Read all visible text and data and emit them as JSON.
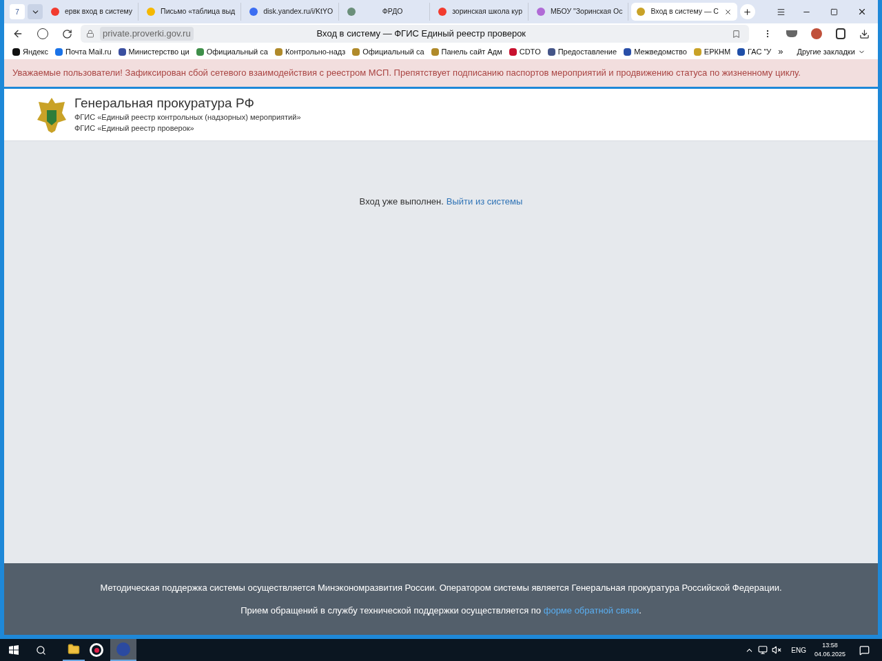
{
  "browser": {
    "tab_count": "7",
    "tabs": [
      {
        "title": "ервк вход в систему",
        "selected": false
      },
      {
        "title": "Письмо «таблица выд",
        "selected": false
      },
      {
        "title": "disk.yandex.ru/i/KtYO",
        "selected": false
      },
      {
        "title": "ФРДО",
        "selected": false
      },
      {
        "title": "зоринская школа кур",
        "selected": false
      },
      {
        "title": "МБОУ \"Зоринская Ос",
        "selected": false
      },
      {
        "title": "Вход в систему — С",
        "selected": true
      }
    ],
    "url": "private.proverki.gov.ru",
    "page_title": "Вход в систему — ФГИС Единый реестр проверок",
    "bookmarks": [
      "Яндекс",
      "Почта Mail.ru",
      "Министерство ци",
      "Официальный са",
      "Контрольно-надз",
      "Официальный са",
      "Панель сайт Адм",
      "CDTO",
      "Предоставление",
      "Межведомство",
      "ЕРКНМ",
      "ГАС \"У"
    ],
    "more_bookmarks": "»",
    "other_bookmarks": "Другие закладки"
  },
  "alert": "Уважаемые пользователи! Зафиксирован сбой сетевого взаимодействия с реестром МСП. Препятствует подписанию паспортов мероприятий и продвижению статуса по жизненному циклу.",
  "header": {
    "title": "Генеральная прокуратура РФ",
    "subtitles": [
      "ФГИС «Единый реестр контрольных (надзорных) мероприятий»",
      "ФГИС «Единый реестр проверок»"
    ]
  },
  "body": {
    "message": "Вход уже выполнен.",
    "logout_link": "Выйти из системы"
  },
  "footer": {
    "line_1": "Методическая поддержка системы осуществляется Минэкономразвития России. Оператором системы является Генеральная прокуратура Российской Федерации.",
    "line_2": "Прием обращений в службу технической поддержки осуществляется по",
    "line_2_link": "форме обратной связи",
    "line_2_end": "."
  },
  "taskbar": {
    "language": "ENG",
    "time": "13:58",
    "date": "04.06.2025"
  }
}
